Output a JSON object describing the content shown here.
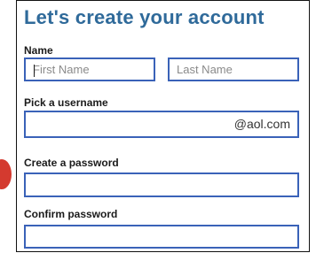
{
  "form": {
    "title": "Let's create your account",
    "name_label": "Name",
    "first_name_placeholder": "First Name",
    "last_name_placeholder": "Last Name",
    "username_label": "Pick a username",
    "username_value": "",
    "username_suffix": "@aol.com",
    "password_label": "Create a password",
    "confirm_password_label": "Confirm password"
  },
  "colors": {
    "title": "#2f6a9a",
    "field_border": "#3a62b8",
    "marker": "#d43a2f"
  }
}
